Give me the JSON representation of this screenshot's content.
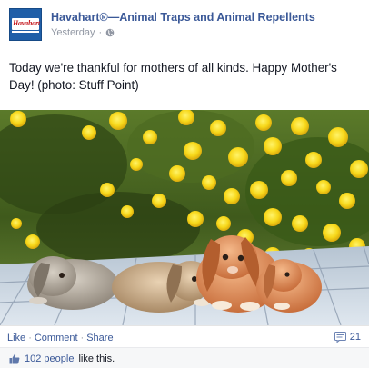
{
  "page": {
    "name": "Havahart®—Animal Traps and Animal Repellents",
    "avatar_logo_text": "Havahart",
    "timestamp": "Yesterday",
    "audience_icon": "globe-icon"
  },
  "post": {
    "text": "Today we're thankful for mothers of all kinds. Happy Mother's Day! (photo: Stuff Point)",
    "photo_description_icon": "photo"
  },
  "actions": {
    "like_label": "Like",
    "comment_label": "Comment",
    "share_label": "Share",
    "separator": "·",
    "comment_count": "21",
    "comment_icon": "comment-icon"
  },
  "likes": {
    "count_text": "102 people",
    "suffix_text": "like this.",
    "icon": "thumbs-up-icon"
  },
  "colors": {
    "link_blue": "#3b5998",
    "meta_gray": "#9197a3",
    "footer_bg": "#f6f7f8",
    "brand_blue": "#1f5fa8",
    "brand_red": "#c4161c"
  }
}
